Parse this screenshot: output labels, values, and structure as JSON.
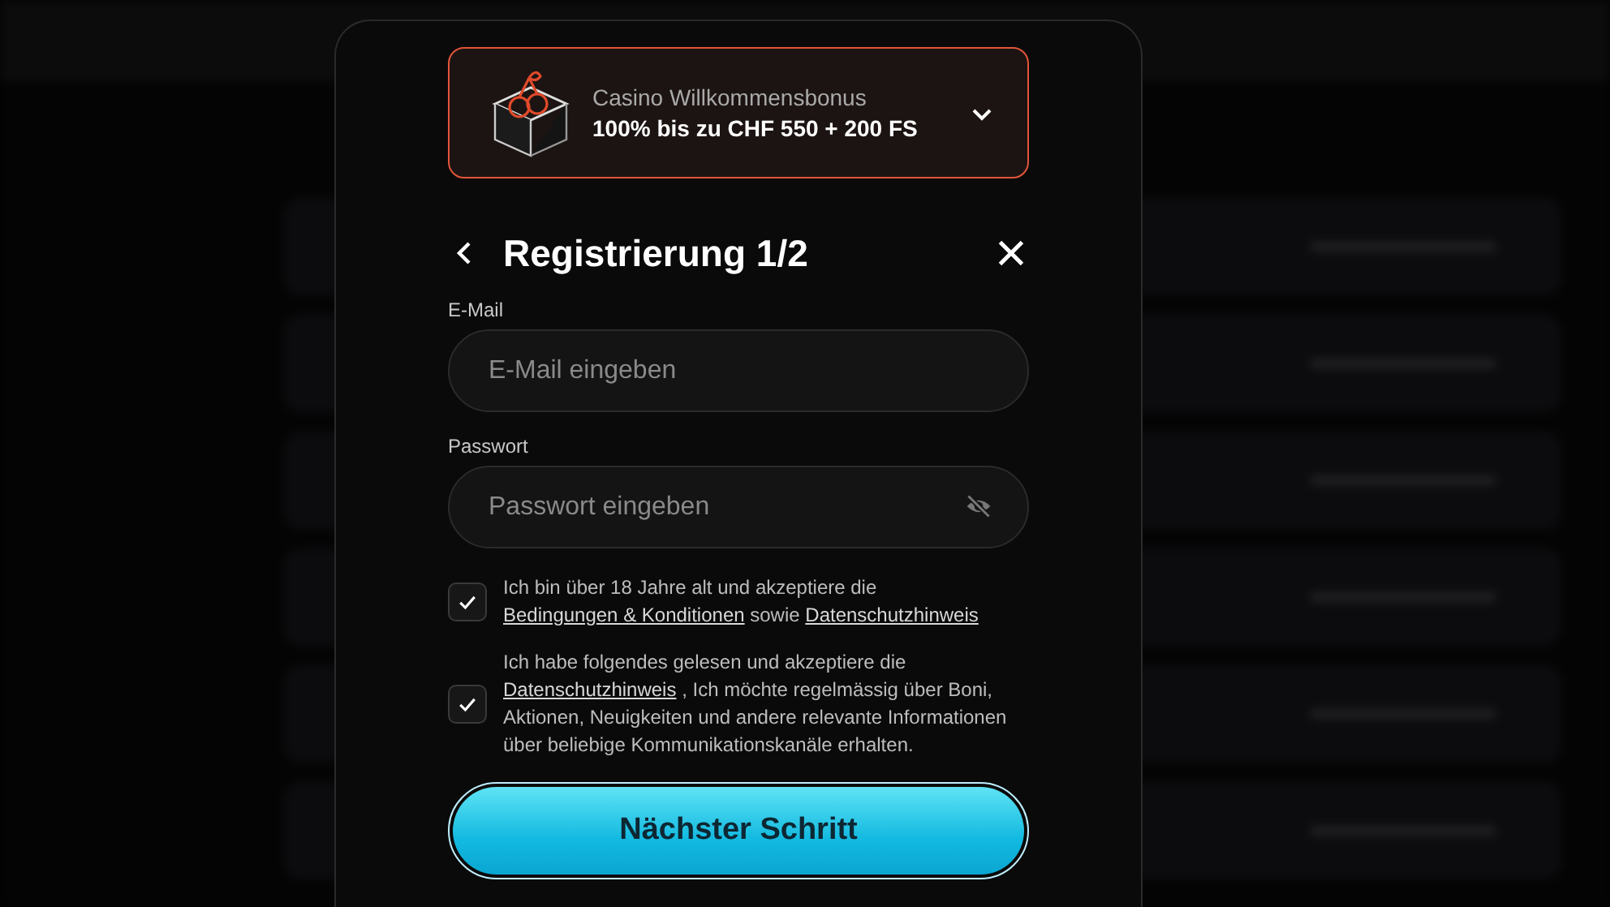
{
  "bonus": {
    "title": "Casino Willkommensbonus",
    "offer": "100% bis zu CHF 550 + 200 FS",
    "expanded": false
  },
  "header": {
    "title": "Registrierung 1/2"
  },
  "fields": [
    {
      "kind": "text",
      "label": "E-Mail",
      "placeholder": "E-Mail eingeben"
    },
    {
      "kind": "password",
      "label": "Passwort",
      "placeholder": "Passwort eingeben"
    }
  ],
  "consents": [
    {
      "checked": true,
      "parts": [
        {
          "kind": "text",
          "text": "Ich bin über 18 Jahre alt und akzeptiere die "
        },
        {
          "kind": "link",
          "text": "Bedingungen & Konditionen"
        },
        {
          "kind": "text",
          "text": " sowie "
        },
        {
          "kind": "link",
          "text": "Datenschutzhinweis"
        }
      ]
    },
    {
      "checked": true,
      "parts": [
        {
          "kind": "text",
          "text": "Ich habe folgendes gelesen und akzeptiere die "
        },
        {
          "kind": "link",
          "text": "Datenschutzhinweis"
        },
        {
          "kind": "text",
          "text": " , Ich möchte regelmässig über Boni, Aktionen, Neuigkeiten und andere relevante Informationen über beliebige Kommunikationskanäle erhalten."
        }
      ]
    }
  ],
  "submit": {
    "label": "Nächster Schritt"
  }
}
